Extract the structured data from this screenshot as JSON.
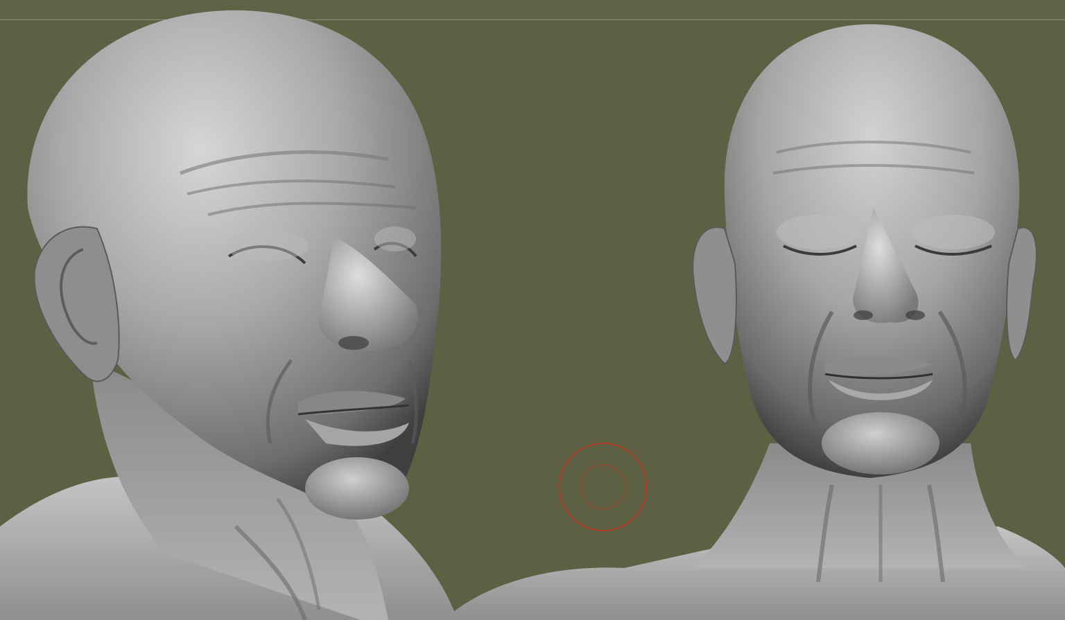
{
  "app": {
    "name": "",
    "viewport_background": "#5d6043"
  },
  "scene": {
    "models": [
      {
        "name": "head-three-quarter-view",
        "material": "matcap-gray",
        "color": "#a9a9a9"
      },
      {
        "name": "head-front-view",
        "material": "matcap-gray",
        "color": "#a9a9a9"
      }
    ]
  },
  "brush": {
    "outer_ring_color": "#c8301f",
    "inner_ring_color": "#a8432f"
  }
}
